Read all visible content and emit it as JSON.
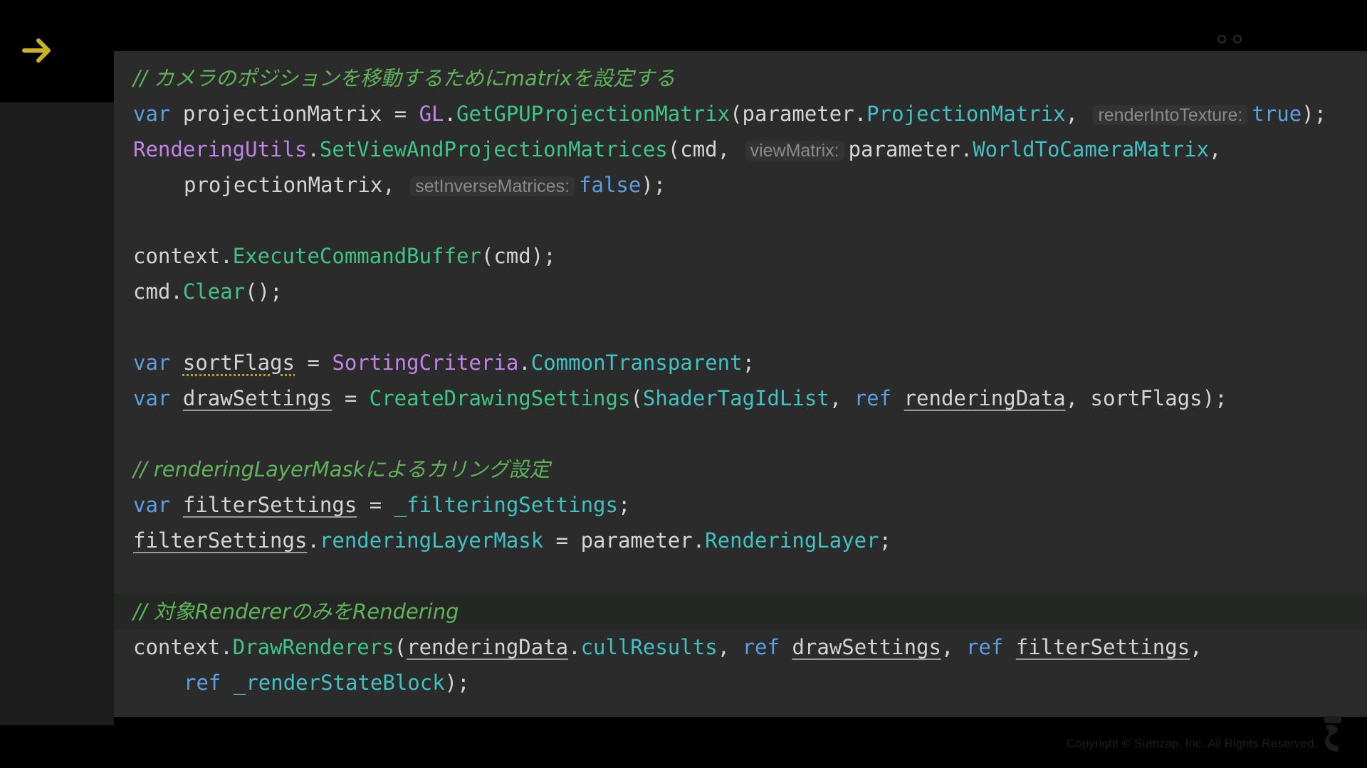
{
  "header": {
    "nav_icon": "arrow-right-icon",
    "menu_icon": "dots-icon"
  },
  "code": {
    "l1": {
      "comment_a": "// カメラのポジションを移動するために",
      "comment_b": "matrix",
      "comment_c": "を設定する"
    },
    "l2": {
      "kw": "var",
      "name": " projectionMatrix = ",
      "cls": "GL",
      "dot": ".",
      "method": "GetGPUProjectionMatrix",
      "paren": "(parameter.",
      "prop": "ProjectionMatrix",
      "comma": ",",
      "hint": "renderIntoTexture:",
      "val": "true",
      "end": ");"
    },
    "l3": {
      "cls": "RenderingUtils",
      "dot": ".",
      "method": "SetViewAndProjectionMatrices",
      "args": "(cmd,",
      "hint": "viewMatrix:",
      "arg2": "parameter.",
      "prop": "WorldToCameraMatrix",
      "end": ","
    },
    "l4": {
      "arg": "projectionMatrix,",
      "hint": "setInverseMatrices:",
      "val": "false",
      "end": ");"
    },
    "l6": {
      "obj": "context.",
      "method": "ExecuteCommandBuffer",
      "end": "(cmd);"
    },
    "l7": {
      "obj": "cmd.",
      "method": "Clear",
      "end": "();"
    },
    "l9": {
      "kw": "var",
      "var": "sortFlags",
      "eq": " = ",
      "cls": "SortingCriteria",
      "dot": ".",
      "prop": "CommonTransparent",
      "end": ";"
    },
    "l10": {
      "kw": "var",
      "var": "drawSettings",
      "eq": " = ",
      "method": "CreateDrawingSettings",
      "p1": "(",
      "prop": "ShaderTagIdList",
      "c1": ", ",
      "kw2": "ref",
      "var2": "renderingData",
      "end": ", sortFlags);"
    },
    "l12": {
      "comment_a": "// ",
      "comment_b": "renderingLayerMask",
      "comment_c": "によるカリング設定"
    },
    "l13": {
      "kw": "var",
      "var": "filterSettings",
      "eq": " = ",
      "prop": "_filteringSettings",
      "end": ";"
    },
    "l14": {
      "var": "filterSettings",
      "dot": ".",
      "prop": "renderingLayerMask",
      "eq": " = parameter.",
      "prop2": "RenderingLayer",
      "end": ";"
    },
    "l16": {
      "comment_a": "// 対象",
      "comment_b": "Renderer",
      "comment_c": "のみを",
      "comment_d": "Rendering"
    },
    "l17": {
      "obj": "context.",
      "method": "DrawRenderers",
      "p1": "(",
      "var": "renderingData",
      "dot": ".",
      "prop": "cullResults",
      "c1": ", ",
      "kw": "ref",
      "var2": "drawSettings",
      "c2": ", ",
      "kw2": "ref",
      "var3": "filterSettings",
      "end": ","
    },
    "l18": {
      "kw": "ref",
      "prop": "_renderStateBlock",
      "end": ");"
    }
  },
  "footer": {
    "copyright": "Copyright © Sumzap, Inc. All Rights Reserved."
  },
  "colors": {
    "comment": "#5fb35a",
    "keyword": "#5c9fe0",
    "class": "#c183e8",
    "method": "#3fc48a",
    "property": "#41c1c1",
    "accent": "#c8b225"
  }
}
